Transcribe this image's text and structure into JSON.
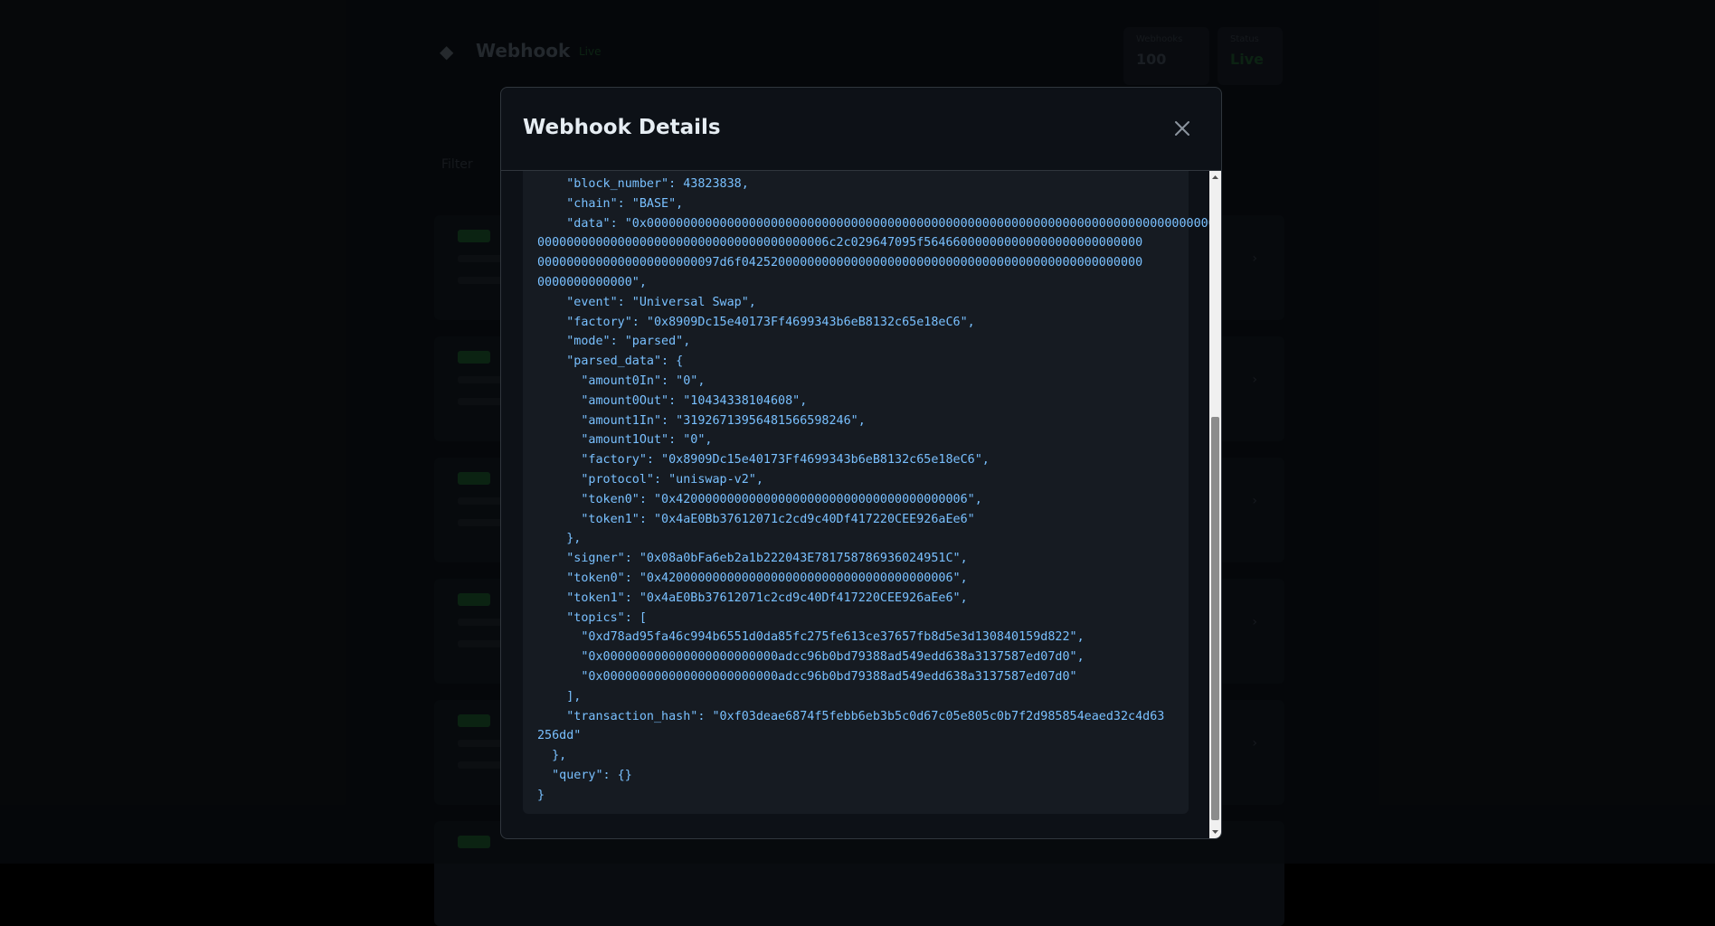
{
  "background": {
    "app_title": "Webhook",
    "live_label": "Live",
    "stats": [
      {
        "label": "Webhooks",
        "value": "100"
      },
      {
        "label": "Status",
        "value": "Live"
      }
    ],
    "filter_label": "Filter"
  },
  "modal": {
    "title": "Webhook Details",
    "close_icon": "close-icon",
    "json_lines": [
      "    \"block_number\": 43823838,",
      "    \"chain\": \"BASE\",",
      "    \"data\": \"0x000000000000000000000000000000000000000000000000000000000000000000000000000000",
      "0000000000000000000000000000000000000006c2c029647095f564660000000000000000000000000",
      "0000000000000000000000097d6f0425200000000000000000000000000000000000000000000000000",
      "0000000000000\",",
      "    \"event\": \"Universal Swap\",",
      "    \"factory\": \"0x8909Dc15e40173Ff4699343b6eB8132c65e18eC6\",",
      "    \"mode\": \"parsed\",",
      "    \"parsed_data\": {",
      "      \"amount0In\": \"0\",",
      "      \"amount0Out\": \"10434338104608\",",
      "      \"amount1In\": \"3192671395648156659824​6\",",
      "      \"amount1Out\": \"0\",",
      "      \"factory\": \"0x8909Dc15e40173Ff4699343b6eB8132c65e18eC6\",",
      "      \"protocol\": \"uniswap-v2\",",
      "      \"token0\": \"0x4200000000000000000000000000000000000006\",",
      "      \"token1\": \"0x4aE0Bb37612071c2cd9c40Df417220CEE926aEe6\"",
      "    },",
      "    \"signer\": \"0x08a0bFa6eb2a1b222043E781758786936024951C\",",
      "    \"token0\": \"0x4200000000000000000000000000000000000006\",",
      "    \"token1\": \"0x4aE0Bb37612071c2cd9c40Df417220CEE926aEe6\",",
      "    \"topics\": [",
      "      \"0xd78ad95fa46c994b6551d0da85fc275fe613ce37657fb8d5e3d130840159d822\",",
      "      \"0x000000000000000000000000adcc96b0bd79388ad549edd638a3137587ed07d0\",",
      "      \"0x000000000000000000000000adcc96b0bd79388ad549edd638a3137587ed07d0\"",
      "    ],",
      "    \"transaction_hash\": \"0xf03deae6874f5febb6eb3b5c0d67c05e805c0b7f2d985854eaed32c4d63",
      "256dd\"",
      "  },",
      "  \"query\": {}",
      "}"
    ]
  },
  "colors": {
    "modal_bg": "#0d1117",
    "code_bg": "#161b22",
    "code_text": "#79c0ff",
    "title_text": "#e6edf3",
    "border": "#30363d"
  }
}
